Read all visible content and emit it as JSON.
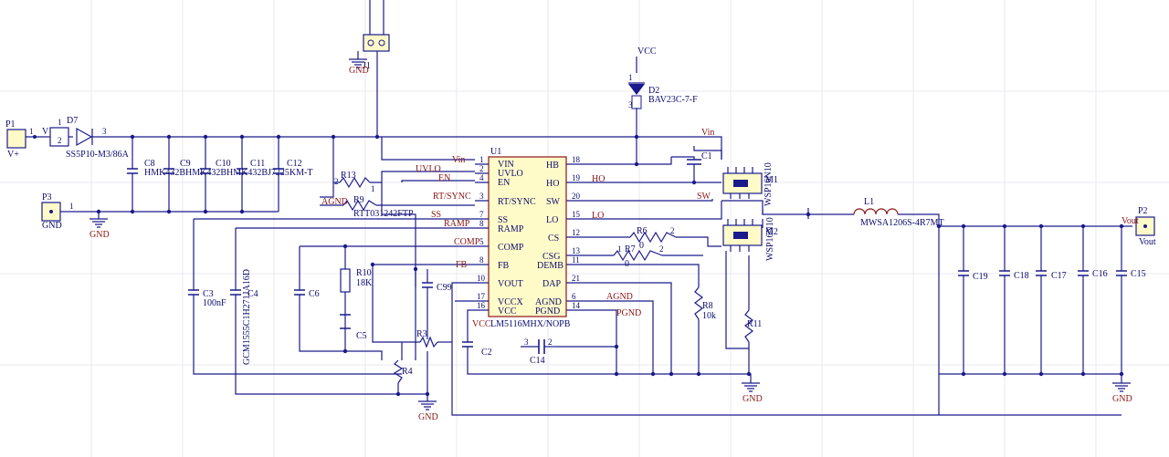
{
  "schematic": {
    "nets": {
      "vin": "Vin",
      "vcc": "VCC",
      "gnd": "GND",
      "agnd": "AGND",
      "pgnd": "PGND",
      "sw": "SW",
      "uvlo": "UVLO",
      "en": "EN",
      "rt_sync": "RT/SYNC",
      "ss": "SS",
      "ramp": "RAMP",
      "comp": "COMP",
      "fb": "FB",
      "ho": "HO",
      "lo": "LO",
      "vout": "Vout",
      "vplus": "V+",
      "v": "V"
    },
    "ic": {
      "designator": "U1",
      "part": "LM5116MHX/NOPB",
      "left_pins": [
        {
          "num": "1",
          "name": "VIN"
        },
        {
          "num": "2",
          "name": "UVLO"
        },
        {
          "num": "4",
          "name": "EN"
        },
        {
          "num": "3",
          "name": "RT/SYNC"
        },
        {
          "num": "7",
          "name": "SS"
        },
        {
          "num": "8",
          "name": "RAMP"
        },
        {
          "num": "5",
          "name": "COMP"
        },
        {
          "num": "8",
          "name": "FB"
        },
        {
          "num": "10",
          "name": "VOUT"
        },
        {
          "num": "17",
          "name": "VCCX"
        },
        {
          "num": "16",
          "name": "VCC"
        }
      ],
      "right_pins": [
        {
          "num": "18",
          "name": "HB"
        },
        {
          "num": "19",
          "name": "HO"
        },
        {
          "num": "20",
          "name": "SW"
        },
        {
          "num": "15",
          "name": "LO"
        },
        {
          "num": "12",
          "name": "CS"
        },
        {
          "num": "13",
          "name": "CSG"
        },
        {
          "num": "11",
          "name": "DEMB"
        },
        {
          "num": "21",
          "name": "DAP"
        },
        {
          "num": "6",
          "name": "AGND"
        },
        {
          "num": "14",
          "name": "PGND"
        }
      ]
    },
    "connectors": {
      "p1": {
        "ref": "P1",
        "net": "V+"
      },
      "p2": {
        "ref": "P2",
        "net": "Vout"
      },
      "p3": {
        "ref": "P3",
        "net": "GND"
      },
      "j1": {
        "ref": "J1"
      }
    },
    "diodes": {
      "d7": {
        "ref": "D7",
        "value": "SS5P10-M3/86A"
      },
      "d2": {
        "ref": "D2",
        "value": "BAV23C-7-F"
      }
    },
    "mosfets": {
      "m1": {
        "ref": "M1",
        "value": "WSP16N10"
      },
      "m2": {
        "ref": "M2",
        "value": "WSP16N10"
      }
    },
    "inductor": {
      "ref": "L1",
      "value": "MWSA1206S-4R7MT"
    },
    "resistors": {
      "r13": "R13",
      "r9": {
        "ref": "R9",
        "value": "RTT031242FTP"
      },
      "r10": {
        "ref": "R10",
        "value": "18K"
      },
      "r3": "R3",
      "r4": "R4",
      "r6": {
        "ref": "R6",
        "value": "0"
      },
      "r7": {
        "ref": "R7",
        "value": "0"
      },
      "r8": {
        "ref": "R8",
        "value": "10k"
      },
      "r11": "R11"
    },
    "capacitors": {
      "c8": "C8",
      "c9": "C9",
      "c10": "C10",
      "c11": "C11",
      "c12": "C12",
      "input_bank_values": "HMK432BHMK432BHMK432BJ7225KM-T",
      "c3": {
        "ref": "C3",
        "value": "100nF"
      },
      "c4": {
        "ref": "C4",
        "value": "GCM1555C1H271JA16D"
      },
      "c6": "C6",
      "c5": "C5",
      "c99": "C99",
      "c2": "C2",
      "c14": "C14",
      "c1": "C1",
      "c19": "C19",
      "c18": "C18",
      "c17": "C17",
      "c16": "C16",
      "c15": "C15"
    },
    "pin_numbers": {
      "one": "1",
      "two": "2",
      "three": "3",
      "four": "4",
      "five": "5",
      "six": "6",
      "seven": "7",
      "eight": "8"
    }
  }
}
